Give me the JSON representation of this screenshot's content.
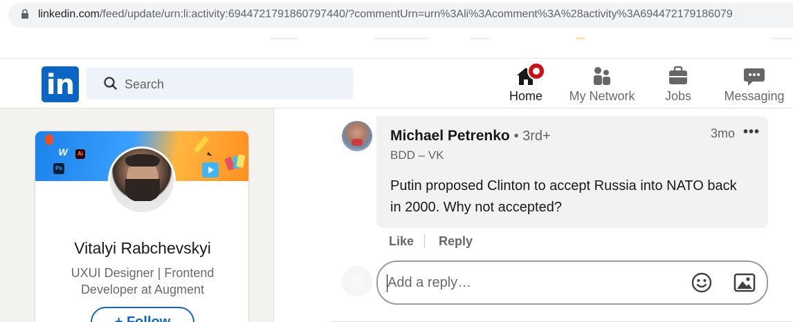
{
  "browser": {
    "url_host": "linkedin.com",
    "url_path": "/feed/update/urn:li:activity:6944721791860797440/?commentUrn=urn%3Ali%3Acomment%3A%28activity%3A694472179186079"
  },
  "nav": {
    "logo_text": "in",
    "search_placeholder": "Search",
    "items": [
      {
        "label": "Home",
        "icon": "home-icon",
        "active": true
      },
      {
        "label": "My Network",
        "icon": "people-icon"
      },
      {
        "label": "Jobs",
        "icon": "briefcase-icon"
      },
      {
        "label": "Messaging",
        "icon": "chat-icon"
      }
    ],
    "colors": {
      "brand": "#0a66c2",
      "badge": "#cc1016"
    }
  },
  "profile": {
    "name": "Vitalyi Rabchevskyi",
    "headline_line1": "UXUI Designer | Frontend",
    "headline_line2": "Developer at Augment",
    "follow_label": "+ Follow",
    "banner_chips": [
      "W",
      "Ai",
      "Ps"
    ]
  },
  "comment": {
    "author": "Michael Petrenko",
    "degree": "• 3rd+",
    "subtitle": "BDD – VK",
    "time": "3mo",
    "more": "•••",
    "text": "Putin proposed Clinton to accept Russia into NATO back in 2000. Why not accepted?",
    "like_label": "Like",
    "reply_label": "Reply"
  },
  "reply_box": {
    "placeholder": "Add a reply…",
    "emoji_icon": "emoji-icon",
    "image_icon": "image-icon"
  }
}
